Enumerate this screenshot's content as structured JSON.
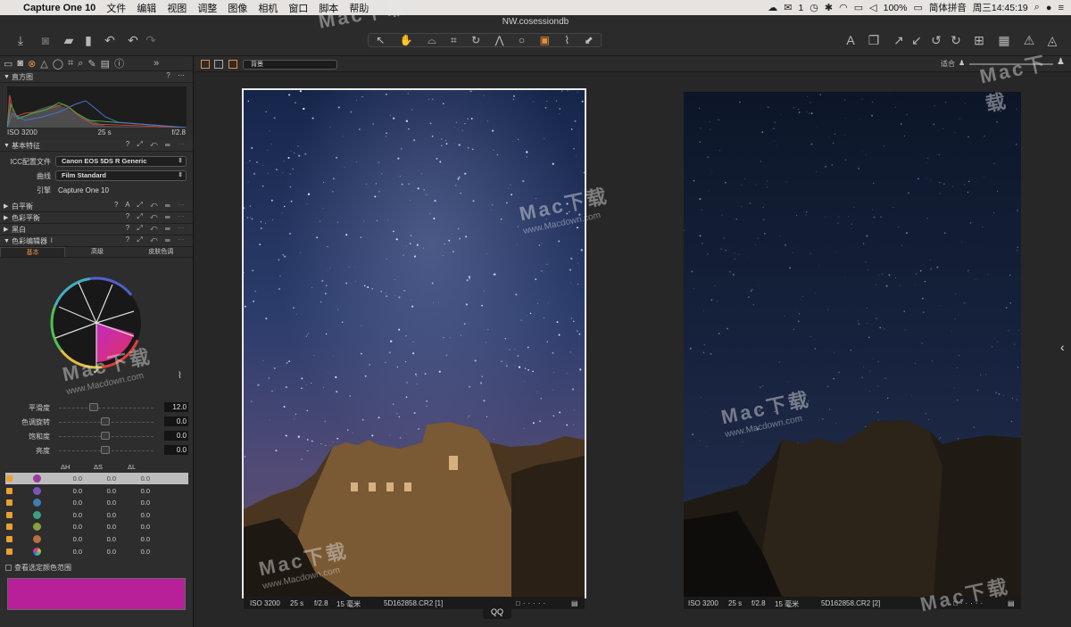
{
  "menubar": {
    "app": "Capture One 10",
    "items": [
      "文件",
      "编辑",
      "视图",
      "调整",
      "图像",
      "相机",
      "窗口",
      "脚本",
      "帮助"
    ],
    "status": {
      "badge": "1",
      "battery": "100%",
      "input_method": "简体拼音",
      "clock": "周三14:45:19"
    }
  },
  "toolbar": {
    "document_title": "NW.cosessiondb"
  },
  "tool_tabs": [
    "folder",
    "camera",
    "color",
    "exposure",
    "lens",
    "crop",
    "search",
    "brush",
    "metadata",
    "info"
  ],
  "histogram": {
    "title": "直方图",
    "iso": "ISO 3200",
    "shutter": "25 s",
    "aperture": "f/2.8"
  },
  "basic": {
    "title": "基本特征",
    "icc_label": "ICC配置文件",
    "icc_value": "Canon EOS 5DS R Generic",
    "curve_label": "曲线",
    "curve_value": "Film Standard",
    "engine_label": "引擎",
    "engine_value": "Capture One 10"
  },
  "sections": {
    "white_balance": "白平衡",
    "color_balance": "色彩平衡",
    "bw": "黑白",
    "color_editor": "色彩编辑器"
  },
  "color_editor": {
    "tabs": [
      "基本",
      "高级",
      "皮肤色调"
    ],
    "sliders": [
      {
        "label": "平滑度",
        "value": "12.0"
      },
      {
        "label": "色调旋转",
        "value": "0.0"
      },
      {
        "label": "饱和度",
        "value": "0.0"
      },
      {
        "label": "亮度",
        "value": "0.0"
      }
    ],
    "columns": [
      "ΔH",
      "ΔS",
      "ΔL"
    ],
    "ranges": [
      {
        "color": "#9a3aa0",
        "h": "0.0",
        "s": "0.0",
        "l": "0.0"
      },
      {
        "color": "#7a55b8",
        "h": "0.0",
        "s": "0.0",
        "l": "0.0"
      },
      {
        "color": "#3d7fb0",
        "h": "0.0",
        "s": "0.0",
        "l": "0.0"
      },
      {
        "color": "#3aa080",
        "h": "0.0",
        "s": "0.0",
        "l": "0.0"
      },
      {
        "color": "#88a040",
        "h": "0.0",
        "s": "0.0",
        "l": "0.0"
      },
      {
        "color": "#b87040",
        "h": "0.0",
        "s": "0.0",
        "l": "0.0"
      },
      {
        "color": "rainbow",
        "h": "0.0",
        "s": "0.0",
        "l": "0.0"
      }
    ],
    "show_range_label": "查看选定颜色范围",
    "swatch_color": "#b82099"
  },
  "viewer": {
    "background": "背景",
    "fit": "适合",
    "photos": [
      {
        "iso": "ISO 3200",
        "shutter": "25 s",
        "aperture": "f/2.8",
        "focal": "15 毫米",
        "file": "5D162858.CR2 [1]"
      },
      {
        "iso": "ISO 3200",
        "shutter": "25 s",
        "aperture": "f/2.8",
        "focal": "15 毫米",
        "file": "5D162858.CR2 [2]"
      }
    ],
    "qq": "QQ"
  },
  "watermark": {
    "title": "Mac下载",
    "url": "www.Macdown.com"
  }
}
